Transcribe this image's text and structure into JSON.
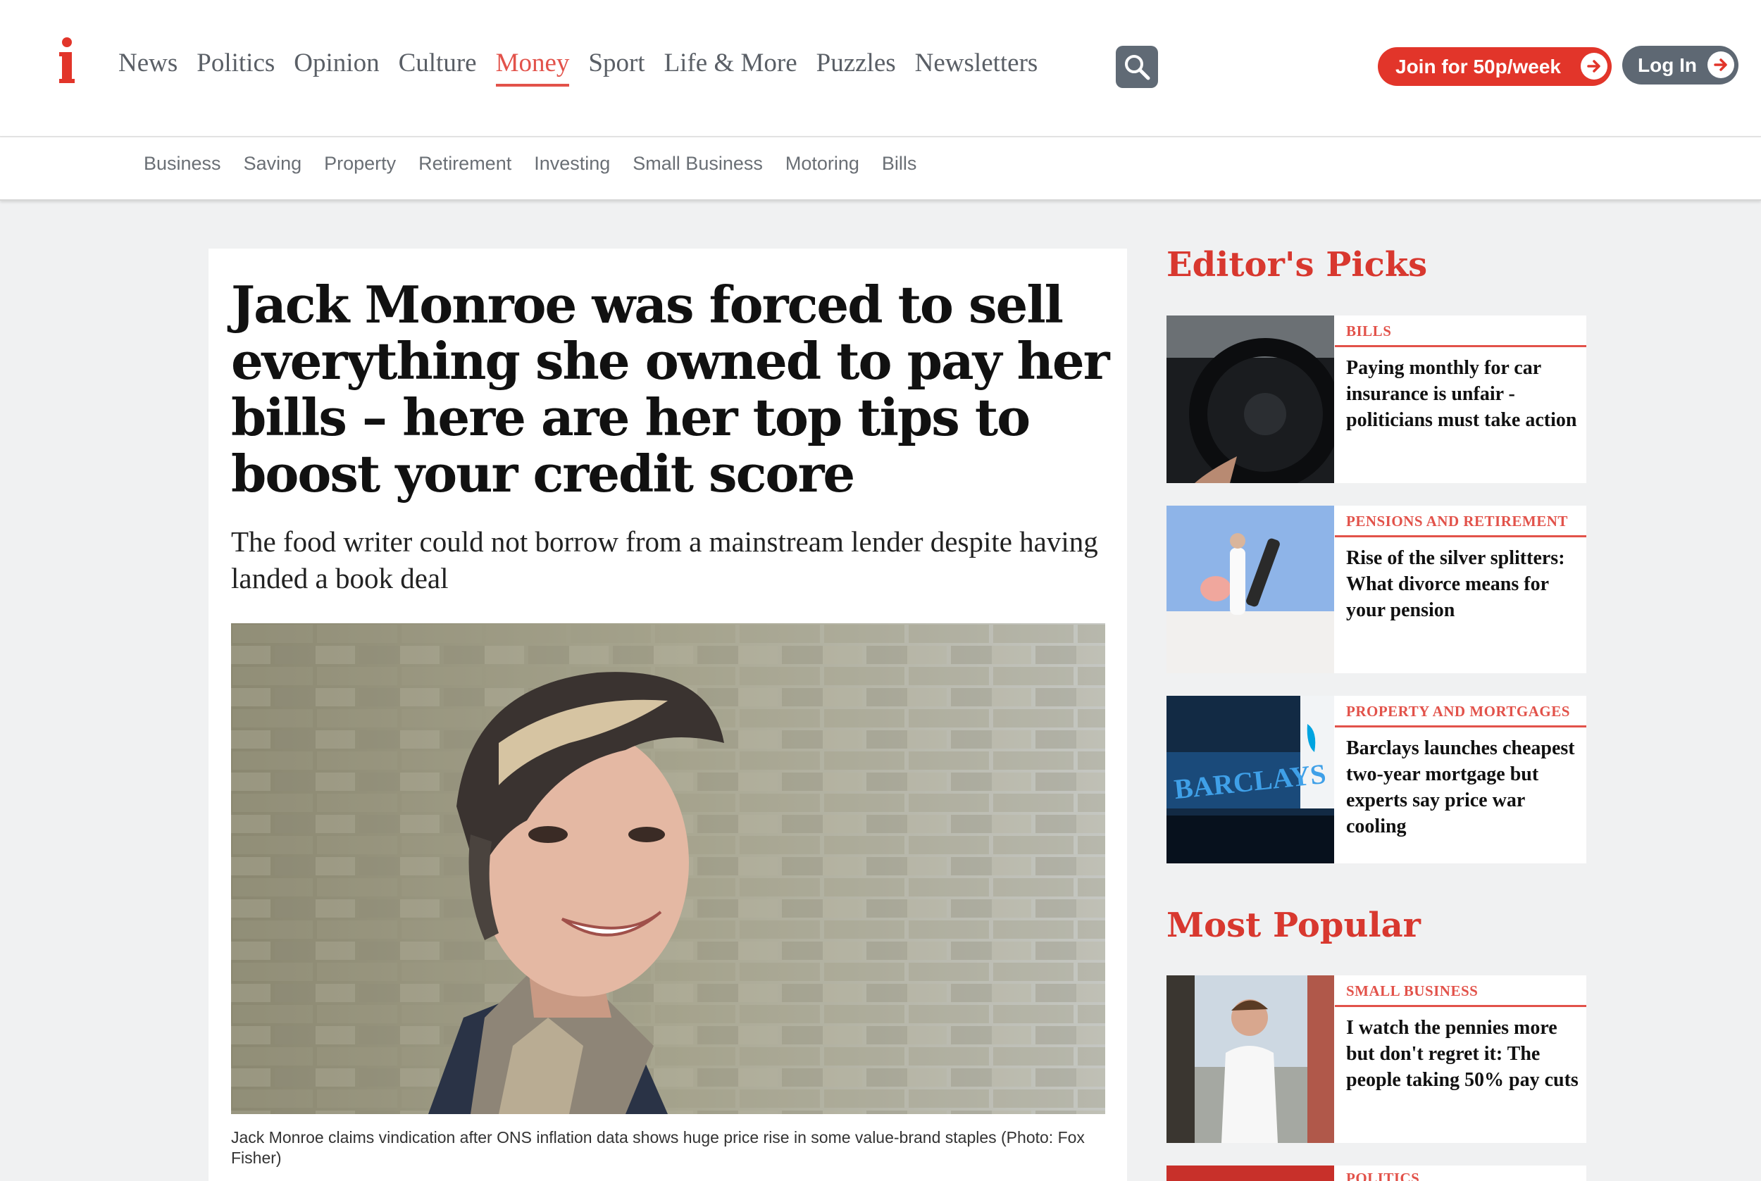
{
  "header": {
    "logo_letter": "i",
    "nav": [
      {
        "label": "News",
        "active": false
      },
      {
        "label": "Politics",
        "active": false
      },
      {
        "label": "Opinion",
        "active": false
      },
      {
        "label": "Culture",
        "active": false
      },
      {
        "label": "Money",
        "active": true
      },
      {
        "label": "Sport",
        "active": false
      },
      {
        "label": "Life & More",
        "active": false
      },
      {
        "label": "Puzzles",
        "active": false
      },
      {
        "label": "Newsletters",
        "active": false
      }
    ],
    "search_icon": "search-icon",
    "join_label": "Join for 50p/week",
    "login_label": "Log In",
    "accent_color": "#e2352a"
  },
  "subnav": [
    "Business",
    "Saving",
    "Property",
    "Retirement",
    "Investing",
    "Small Business",
    "Motoring",
    "Bills"
  ],
  "article": {
    "headline": "Jack Monroe was forced to sell everything she owned to pay her bills – here are her top tips to boost your credit score",
    "standfirst": "The food writer could not borrow from a mainstream lender despite having landed a book deal",
    "caption": "Jack Monroe claims vindication after ONS inflation data shows huge price rise in some value-brand staples (Photo: Fox Fisher)"
  },
  "sidebar": {
    "editors_picks_heading": "Editor's Picks",
    "editors_picks": [
      {
        "tag": "BILLS",
        "title": "Paying monthly for car insurance is unfair - politicians must take action"
      },
      {
        "tag": "PENSIONS AND RETIREMENT",
        "title": "Rise of the silver splitters: What divorce means for your pension"
      },
      {
        "tag": "PROPERTY AND MORTGAGES",
        "title": "Barclays launches cheapest two-year mortgage but experts say price war cooling"
      }
    ],
    "most_popular_heading": "Most Popular",
    "most_popular": [
      {
        "tag": "SMALL BUSINESS",
        "title": "I watch the pennies more but don't regret it: The people taking 50% pay cuts"
      },
      {
        "tag": "POLITICS",
        "title": ""
      }
    ],
    "thumb_text_barclays": "BARCLAYS"
  }
}
